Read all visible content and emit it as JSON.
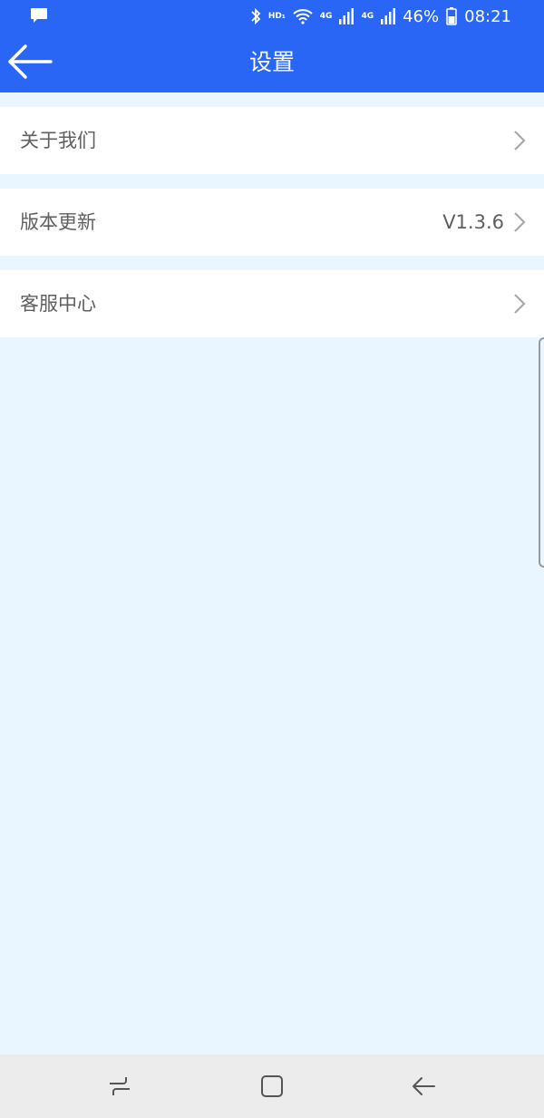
{
  "status_bar": {
    "hd_label": "HD₁",
    "net1": "4G",
    "net2": "4G",
    "battery": "46%",
    "time": "08:21"
  },
  "app_bar": {
    "title": "设置"
  },
  "settings": {
    "items": [
      {
        "label": "关于我们",
        "value": ""
      },
      {
        "label": "版本更新",
        "value": "V1.3.6"
      },
      {
        "label": "客服中心",
        "value": ""
      }
    ]
  },
  "icons": {
    "message": "message-icon",
    "bluetooth": "bluetooth-icon",
    "wifi": "wifi-icon",
    "signal": "signal-icon",
    "battery": "battery-icon",
    "back": "arrow-left-icon",
    "chevron": "chevron-right-icon",
    "recents": "recents-icon",
    "home": "home-icon",
    "nav_back": "nav-back-icon"
  },
  "colors": {
    "primary": "#2a66f6",
    "background": "#eaf6ff",
    "row": "#ffffff",
    "text": "#5f5f5f",
    "navbar": "#ececec"
  }
}
